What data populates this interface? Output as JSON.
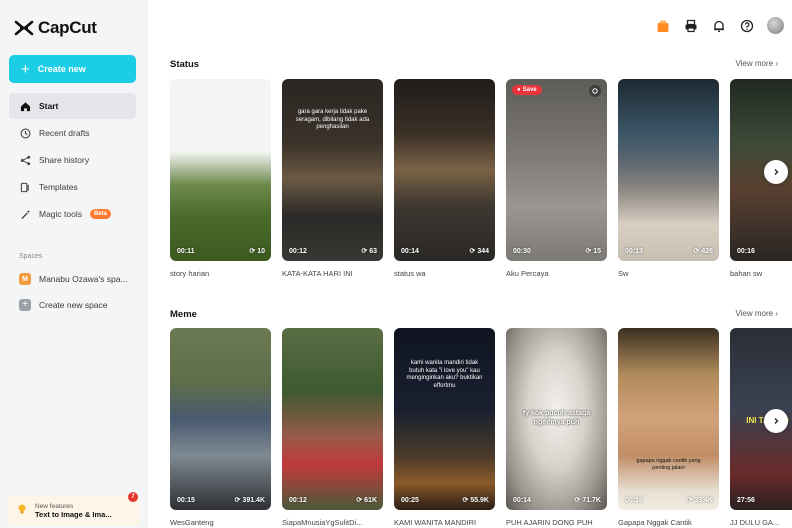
{
  "app": {
    "name": "CapCut"
  },
  "sidebar": {
    "create_label": "Create new",
    "items": [
      {
        "label": "Start",
        "icon": "home-icon"
      },
      {
        "label": "Recent drafts",
        "icon": "clock-icon"
      },
      {
        "label": "Share history",
        "icon": "share-icon"
      },
      {
        "label": "Templates",
        "icon": "template-icon"
      },
      {
        "label": "Magic tools",
        "icon": "magic-wand-icon",
        "badge": "Beta"
      }
    ],
    "spaces_label": "Spaces",
    "space_name": "Manabu Ozawa's spa...",
    "space_initial": "M",
    "new_space_label": "Create new space",
    "new_features": {
      "label": "New features",
      "title": "Text to Image & Ima...",
      "badge": "7"
    }
  },
  "topbar": {
    "icons": [
      "gift-icon",
      "printer-icon",
      "bell-icon",
      "help-icon",
      "avatar"
    ]
  },
  "sections": {
    "status": {
      "title": "Status",
      "view_more": "View more",
      "cards": [
        {
          "title": "story harian",
          "duration": "00:11",
          "uses": "10"
        },
        {
          "title": "KATA-KATA HARI INI",
          "duration": "00:12",
          "uses": "63",
          "overlay": "gara gara kerja tidak pake seragam, dibilang tidak ada penghasilan"
        },
        {
          "title": "status wa",
          "duration": "00:14",
          "uses": "344",
          "overlay": ""
        },
        {
          "title": "Aku Percaya",
          "duration": "00:30",
          "uses": "15",
          "save": "Save"
        },
        {
          "title": "Sw",
          "duration": "00:13",
          "uses": "426"
        },
        {
          "title": "bahan sw",
          "duration": "00:16",
          "uses": ""
        }
      ]
    },
    "meme": {
      "title": "Meme",
      "view_more": "View more",
      "cards": [
        {
          "title": "WesGanteng",
          "duration": "00:15",
          "uses": "391.4K"
        },
        {
          "title": "SiapaMnusiaYgSulitDi...",
          "duration": "00:12",
          "uses": "61K"
        },
        {
          "title": "KAMI WANITA MANDIRI",
          "duration": "00:25",
          "uses": "55.9K",
          "overlay": "kami wanita mandiri tidak butuh kata \"i love you\" kau menginginkan aku? buktikan effortmu"
        },
        {
          "title": "PUH AJARIN DONG PUH",
          "duration": "00:14",
          "uses": "71.7K",
          "overlay": "ty kok pucuh astaga ngeihnya puh"
        },
        {
          "title": "Gapapa Nggak Cantik",
          "duration": "00:16",
          "uses": "33.4K",
          "overlay": "gapapa nggak cantik yang penting jalani"
        },
        {
          "title": "JJ DULU GA...",
          "duration": "27:56",
          "uses": "",
          "overlay": "INI TAU KO"
        }
      ]
    }
  },
  "colors": {
    "accent": "#1ccde6",
    "beta": "#ff7a2e",
    "save": "#e8343a"
  }
}
